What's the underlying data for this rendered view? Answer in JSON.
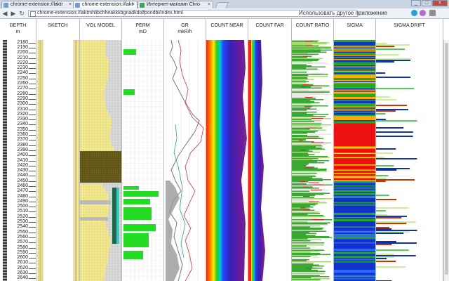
{
  "browser": {
    "tabs": [
      {
        "title": "chrome-extension://laktr",
        "active": false
      },
      {
        "title": "chrome-extension://lakt",
        "active": true
      },
      {
        "title": "Интернет-магазин Chro",
        "active": false
      }
    ],
    "address": "chrome-extension://laktmhlibchheakkkbgnadkdolfpondbi/index.html",
    "hint": "Использовать другое приложение"
  },
  "tracks": [
    {
      "id": "depth",
      "title": "DEPTH",
      "unit": "m"
    },
    {
      "id": "sketch",
      "title": "SKETCH",
      "unit": ""
    },
    {
      "id": "vol_model",
      "title": "VOL MODEL",
      "unit": ""
    },
    {
      "id": "perm",
      "title": "PERM",
      "unit": "mD"
    },
    {
      "id": "gr",
      "title": "GR",
      "unit": "mkR/h"
    },
    {
      "id": "count_near",
      "title": "COUNT NEAR",
      "unit": ""
    },
    {
      "id": "count_far",
      "title": "COUNT FAR",
      "unit": ""
    },
    {
      "id": "count_ratio",
      "title": "COUNT RATIO",
      "unit": ""
    },
    {
      "id": "sigma",
      "title": "SIGMA",
      "unit": ""
    },
    {
      "id": "sigma_drift",
      "title": "SIGMA DRIFT",
      "unit": ""
    }
  ],
  "depth_labels": [
    "2180",
    "2190",
    "2200",
    "2210",
    "2220",
    "2230",
    "2240",
    "2250",
    "2260",
    "2270",
    "2280",
    "2290",
    "2300",
    "2310",
    "2320",
    "2330",
    "2340",
    "2350",
    "2360",
    "2370",
    "2380",
    "2390",
    "2400",
    "2410",
    "2420",
    "2430",
    "2440",
    "2450",
    "2460",
    "2470",
    "2480",
    "2490",
    "2500",
    "2510",
    "2520",
    "2530",
    "2540",
    "2550",
    "2560",
    "2570",
    "2580",
    "2590",
    "2600",
    "2610",
    "2620",
    "2630",
    "2640"
  ],
  "depth_range": [
    2175,
    2645
  ],
  "colors": {
    "tab_bg": "#c9d4e3",
    "yellow": "#f2e889",
    "olive": "#6b5e1c",
    "green": "#22dd22",
    "sigma_red": "#ee1111",
    "sigma_blue": "#1133cc"
  }
}
